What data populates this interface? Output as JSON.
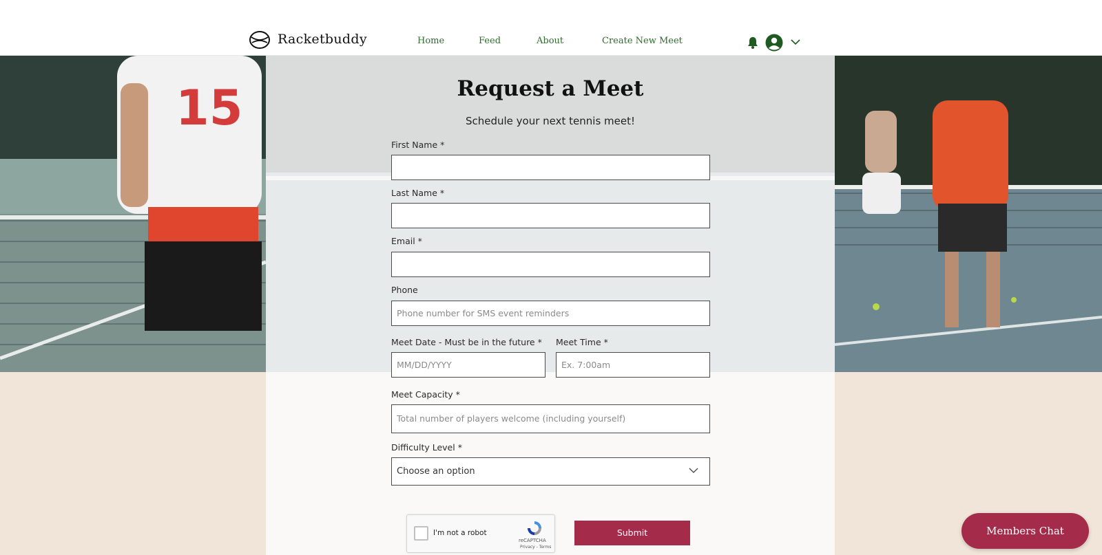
{
  "brand": {
    "name": "Racketbuddy"
  },
  "nav": {
    "items": [
      {
        "label": "Home"
      },
      {
        "label": "Feed"
      },
      {
        "label": "About"
      },
      {
        "label": "Create New Meet"
      }
    ]
  },
  "header_icons": [
    "bell-icon",
    "avatar-icon",
    "chevron-down-icon"
  ],
  "colors": {
    "nav_text": "#2f6b2c",
    "accent": "#a52b4b",
    "page_bg": "#f1e5d9"
  },
  "form": {
    "title": "Request a Meet",
    "subtitle": "Schedule your next tennis meet!",
    "first_name": {
      "label": "First Name *",
      "value": ""
    },
    "last_name": {
      "label": "Last Name *",
      "value": ""
    },
    "email": {
      "label": "Email *",
      "value": ""
    },
    "phone": {
      "label": "Phone",
      "placeholder": "Phone number for SMS event reminders"
    },
    "meet_date": {
      "label": "Meet Date - Must be in the future *",
      "placeholder": "MM/DD/YYYY"
    },
    "meet_time": {
      "label": "Meet Time *",
      "placeholder": "Ex. 7:00am"
    },
    "capacity": {
      "label": "Meet Capacity *",
      "placeholder": "Total number of players welcome (including yourself)"
    },
    "difficulty": {
      "label": "Difficulty Level *",
      "selected": "Choose an option"
    },
    "captcha": {
      "text": "I'm not a robot",
      "brand": "reCAPTCHA",
      "links": "Privacy - Terms"
    },
    "submit_label": "Submit"
  },
  "chat": {
    "label": "Members Chat"
  }
}
